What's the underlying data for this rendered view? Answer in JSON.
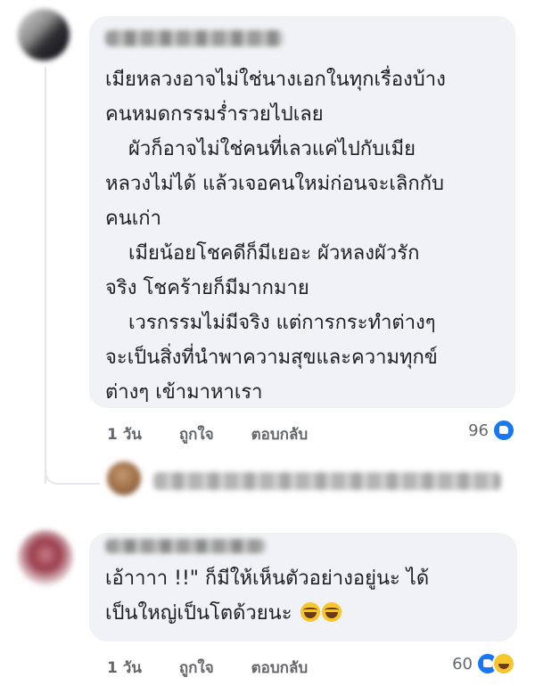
{
  "comments": [
    {
      "lines": [
        "เมียหลวงอาจไม่ใช่นางเอกในทุกเรื่องบ้าง",
        "คนหมดกรรมร่ำรวยไปเลย",
        "ผัวก็อาจไม่ใช่คนที่เลวแค่ไปกับเมีย",
        "หลวงไม่ได้ แล้วเจอคนใหม่ก่อนจะเลิกกับ",
        "คนเก่า",
        "เมียน้อยโชคดีก็มีเยอะ ผัวหลงผัวรัก",
        "จริง โชคร้ายก็มีมากมาย",
        "เวรกรรมไม่มีจริง แต่การกระทำต่างๆ",
        "จะเป็นสิ่งที่นำพาความสุขและความทุกข์",
        "ต่างๆ เข้ามาหาเรา"
      ],
      "time": "1 วัน",
      "like_label": "ถูกใจ",
      "reply_label": "ตอบกลับ",
      "reaction_count": "96",
      "reaction_icons": [
        "like-icon"
      ]
    },
    {
      "lines": [
        "เอ้าาาา !!\" ก็มีให้เห็นตัวอย่างอยู่นะ ได้",
        "เป็นใหญ่เป็นโตด้วยนะ"
      ],
      "time": "1 วัน",
      "like_label": "ถูกใจ",
      "reply_label": "ตอบกลับ",
      "reaction_count": "60",
      "reaction_icons": [
        "like-icon",
        "haha-icon"
      ],
      "emojis": [
        "laughing-tears-emoji",
        "laughing-tears-emoji"
      ]
    }
  ],
  "colors": {
    "bubble": "#f0f2f5",
    "action_text": "#65676b",
    "like_blue": "#1877f2",
    "haha_yellow": "#f7c52d"
  }
}
